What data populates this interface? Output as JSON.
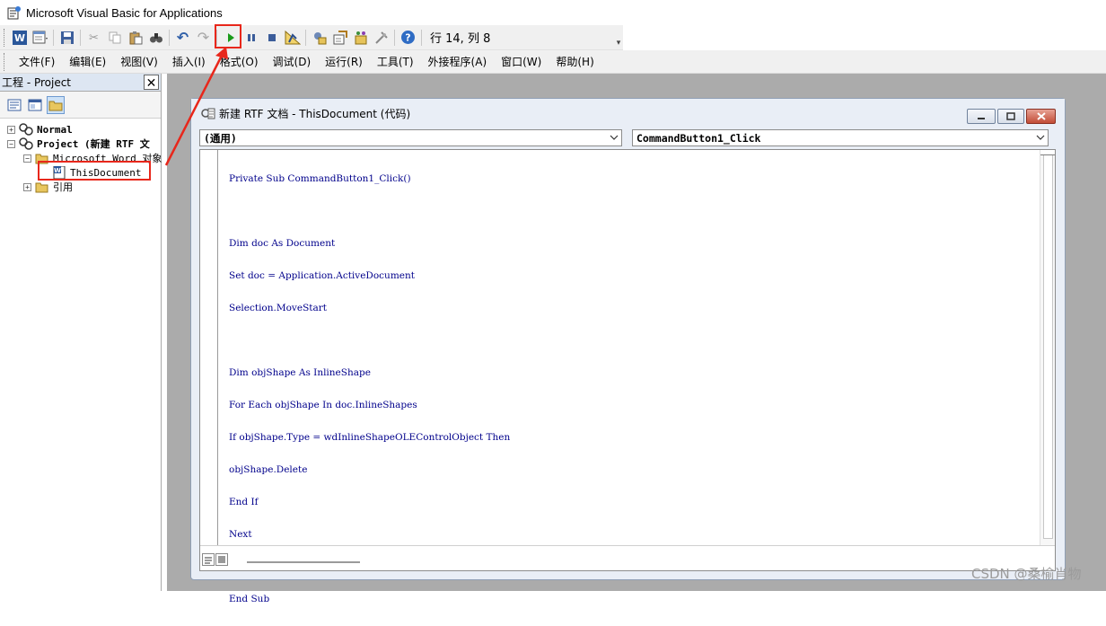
{
  "window": {
    "title": "Microsoft Visual Basic for Applications"
  },
  "toolbar": {
    "buttons": [
      {
        "name": "word-icon",
        "glyph": "W"
      },
      {
        "name": "insert-userform-icon",
        "glyph": "▤"
      },
      {
        "name": "save-icon",
        "glyph": "💾"
      },
      {
        "name": "cut-icon",
        "glyph": "✂"
      },
      {
        "name": "copy-icon",
        "glyph": "⎘"
      },
      {
        "name": "paste-icon",
        "glyph": "📋"
      },
      {
        "name": "find-icon",
        "glyph": "🔭"
      },
      {
        "name": "undo-icon",
        "glyph": "↶"
      },
      {
        "name": "redo-icon",
        "glyph": "↷"
      },
      {
        "name": "run-icon",
        "glyph": "▶"
      },
      {
        "name": "break-icon",
        "glyph": "⏸"
      },
      {
        "name": "reset-icon",
        "glyph": "■"
      },
      {
        "name": "design-mode-icon",
        "glyph": "📐"
      },
      {
        "name": "project-explorer-icon",
        "glyph": "🔧"
      },
      {
        "name": "properties-window-icon",
        "glyph": "📝"
      },
      {
        "name": "object-browser-icon",
        "glyph": "🗃"
      },
      {
        "name": "toolbox-icon",
        "glyph": "🛠"
      },
      {
        "name": "help-icon",
        "glyph": "?"
      }
    ],
    "status": "行 14, 列 8"
  },
  "menu": {
    "items": [
      "文件(F)",
      "编辑(E)",
      "视图(V)",
      "插入(I)",
      "格式(O)",
      "调试(D)",
      "运行(R)",
      "工具(T)",
      "外接程序(A)",
      "窗口(W)",
      "帮助(H)"
    ]
  },
  "project_panel": {
    "title": "工程 - Project",
    "close": "✕",
    "tree": {
      "normal": "Normal",
      "project": "Project (新建 RTF 文",
      "word_objects": "Microsoft Word 对象",
      "this_document": "ThisDocument",
      "references": "引用"
    }
  },
  "code_window": {
    "title": "新建 RTF 文档 - ThisDocument (代码)",
    "object_combo": "(通用)",
    "procedure_combo": "CommandButton1_Click",
    "code_lines": [
      "Private Sub CommandButton1_Click()",
      "",
      "Dim doc As Document",
      "Set doc = Application.ActiveDocument",
      "Selection.MoveStart",
      "",
      "Dim objShape As InlineShape",
      "For Each objShape In doc.InlineShapes",
      "If objShape.Type = wdInlineShapeOLEControlObject Then",
      "objShape.Delete",
      "End If",
      "Next",
      "",
      "End Sub"
    ]
  },
  "watermark": "CSDN @桑榆肖物",
  "colors": {
    "annotation_red": "#e8271b",
    "mdi_background": "#ababab",
    "code_blue": "#00008b",
    "run_green": "#1a9a1a"
  }
}
